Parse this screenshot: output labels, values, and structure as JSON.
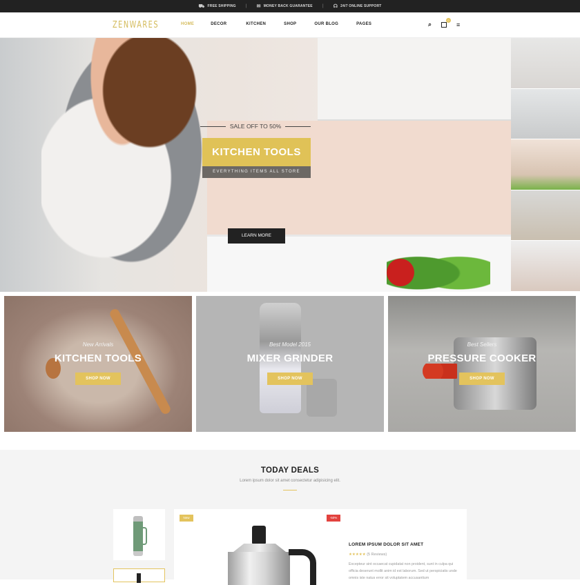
{
  "topbar": {
    "items": [
      {
        "icon": "truck-icon",
        "glyph": "⛟",
        "label": "FREE SHIPPING"
      },
      {
        "icon": "money-icon",
        "glyph": "✉",
        "label": "MONEY BACK GUARANTEE"
      },
      {
        "icon": "headset-icon",
        "glyph": "☊",
        "label": "24/7 ONLINE SUPPORT"
      }
    ],
    "separator": "|"
  },
  "header": {
    "logo": "ZENWARES",
    "nav": [
      "HOME",
      "DECOR",
      "KITCHEN",
      "SHOP",
      "OUR BLOG",
      "PAGES"
    ],
    "active_nav": "HOME",
    "cart_count": "0",
    "icons": {
      "search": "⌕",
      "cart": "👜",
      "menu": "≡"
    }
  },
  "hero": {
    "pretitle": "SALE OFF TO 50%",
    "title": "KITCHEN TOOLS",
    "subtitle": "EVERYTHING ITEMS ALL STORE",
    "cta": "LEARN MORE"
  },
  "banners": [
    {
      "sub": "New Arrivals",
      "title": "KITCHEN TOOLS",
      "cta": "SHOP NOW"
    },
    {
      "sub": "Best Model 2015",
      "title": "MIXER GRINDER",
      "cta": "SHOP NOW"
    },
    {
      "sub": "Best Sellers",
      "title": "PRESSURE COOKER",
      "cta": "SHOP NOW"
    }
  ],
  "deals": {
    "title": "TODAY DEALS",
    "description": "Lorem ipsum dolor sit amet consectetur adipisicing elit.",
    "product": {
      "badge_new": "New",
      "badge_sale": "-50%",
      "name": "LOREM IPSUM DOLOR SIT AMET",
      "stars": "★★★★★",
      "reviews": "(5 Reviews)",
      "text": "Excepteur sint occaecat cupidatat non proident, sunt in culpa qui officia deserunt mollit anim id est laborum. Sed ut perspiciatis unde omnis iste natus error sit voluptatem accusantium"
    }
  },
  "colors": {
    "accent": "#e3c35d",
    "dark": "#222222",
    "sale": "#e2423e"
  }
}
